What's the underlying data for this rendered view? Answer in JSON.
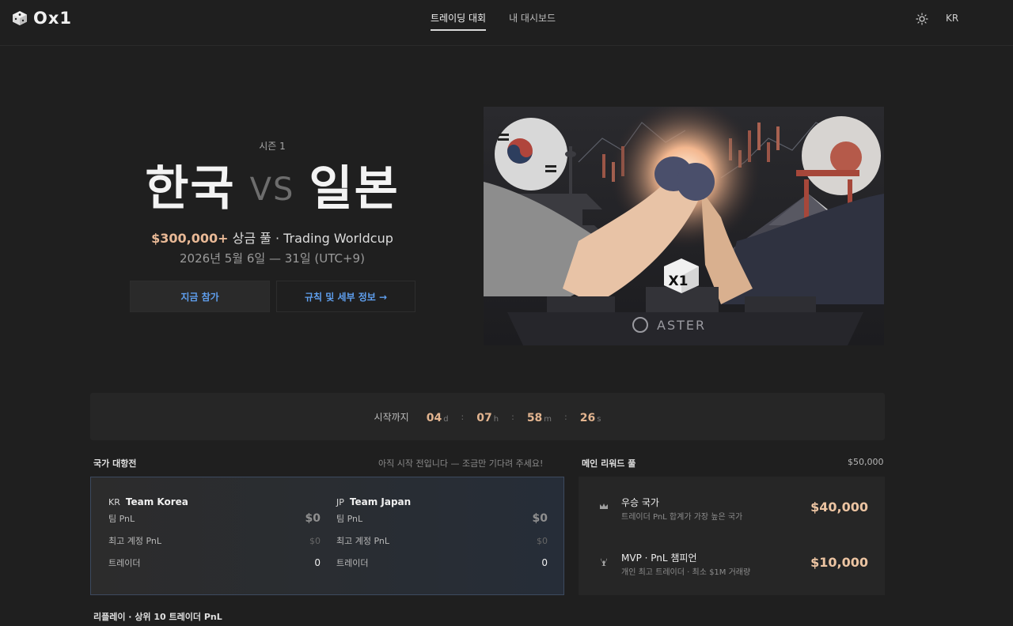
{
  "header": {
    "logo_text": "Ox1",
    "tabs": [
      {
        "label": "트레이딩 대회",
        "active": true
      },
      {
        "label": "내 대시보드",
        "active": false
      }
    ],
    "theme_icon": "sun-icon",
    "language": "KR"
  },
  "hero": {
    "season": "시즌 1",
    "team_a": "한국",
    "vs": "VS",
    "team_b": "일본",
    "prize_amount": "$300,000+",
    "prize_text": "상금 풀 · Trading Worldcup",
    "dates": "2026년 5월 6일 — 31일 (UTC+9)",
    "join_button": "지금 참가",
    "rules_button": "규칙 및 세부 정보 →",
    "art_brand": "ASTER",
    "art_cube_text": "X1"
  },
  "countdown": {
    "label": "시작까지",
    "days": "04",
    "days_unit": "d",
    "hours": "07",
    "hours_unit": "h",
    "minutes": "58",
    "minutes_unit": "m",
    "seconds": "26",
    "seconds_unit": "s"
  },
  "versus": {
    "title": "국가 대항전",
    "note": "아직 시작 전입니다 — 조금만 기다려 주세요!",
    "teams": [
      {
        "code": "KR",
        "name": "Team Korea",
        "team_pnl_label": "팀 PnL",
        "team_pnl": "$0",
        "best_label": "최고 계정 PnL",
        "best": "$0",
        "traders_label": "트레이더",
        "traders": "0"
      },
      {
        "code": "JP",
        "name": "Team Japan",
        "team_pnl_label": "팀 PnL",
        "team_pnl": "$0",
        "best_label": "최고 계정 PnL",
        "best": "$0",
        "traders_label": "트레이더",
        "traders": "0"
      }
    ]
  },
  "rewards": {
    "title": "메인 리워드 풀",
    "total": "$50,000",
    "items": [
      {
        "icon": "crown-icon",
        "title": "우승 국가",
        "subtitle": "트레이더 PnL 합계가 가장 높은 국가",
        "amount": "$40,000"
      },
      {
        "icon": "trophy-icon",
        "title": "MVP · PnL 챔피언",
        "subtitle": "개인 최고 트레이더 · 최소 $1M 거래량",
        "amount": "$10,000"
      }
    ]
  },
  "replay": {
    "title": "리플레이 · 상위 10 트레이더 PnL"
  },
  "colors": {
    "background": "#1f1f1f",
    "accent_gold": "#e9b996",
    "link_blue": "#5f9fee"
  }
}
